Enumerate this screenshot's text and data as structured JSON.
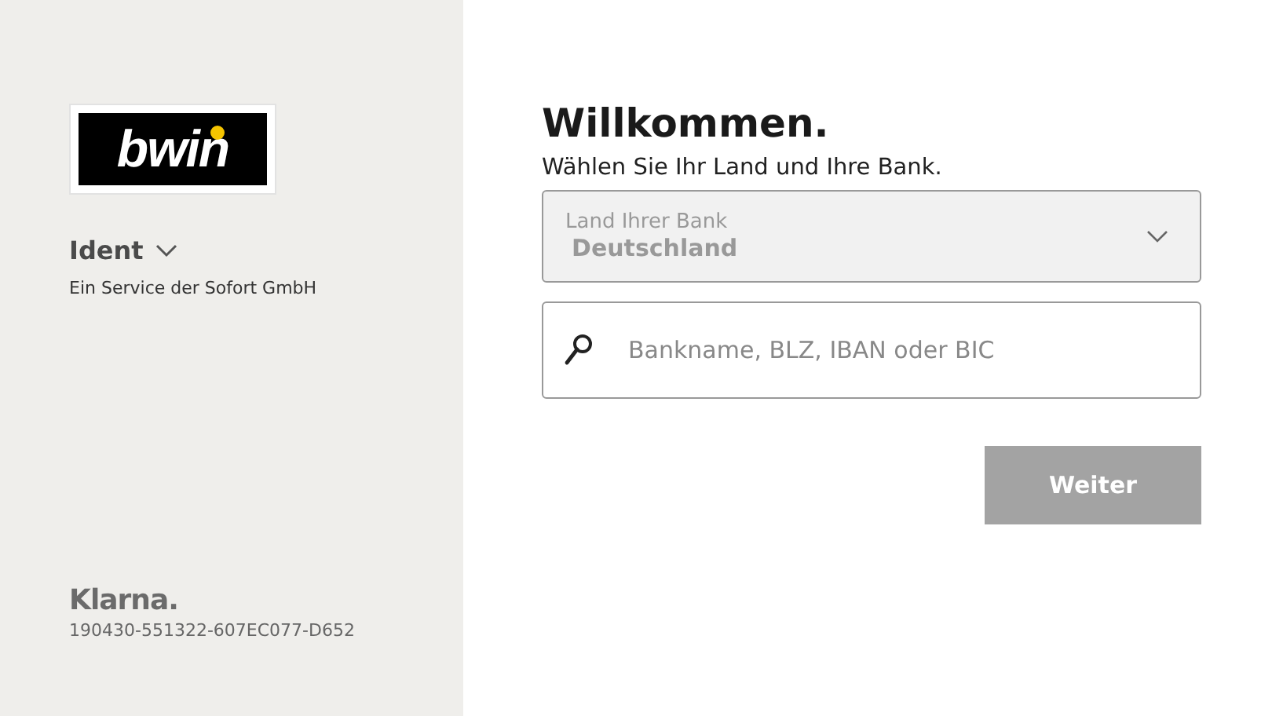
{
  "sidebar": {
    "merchant_logo": "bwin",
    "product": {
      "label": "Ident",
      "expanded": false
    },
    "service_text": "Ein Service der Sofort GmbH",
    "brand": "Klarna.",
    "transaction_id": "190430-551322-607EC077-D652"
  },
  "main": {
    "title": "Willkommen.",
    "subtitle": "Wählen Sie Ihr Land und Ihre Bank.",
    "country_select": {
      "label": "Land Ihrer Bank",
      "value": "Deutschland",
      "disabled": true
    },
    "bank_search": {
      "placeholder": "Bankname, BLZ, IBAN oder BIC"
    },
    "next_button": {
      "label": "Weiter",
      "disabled": true
    }
  }
}
